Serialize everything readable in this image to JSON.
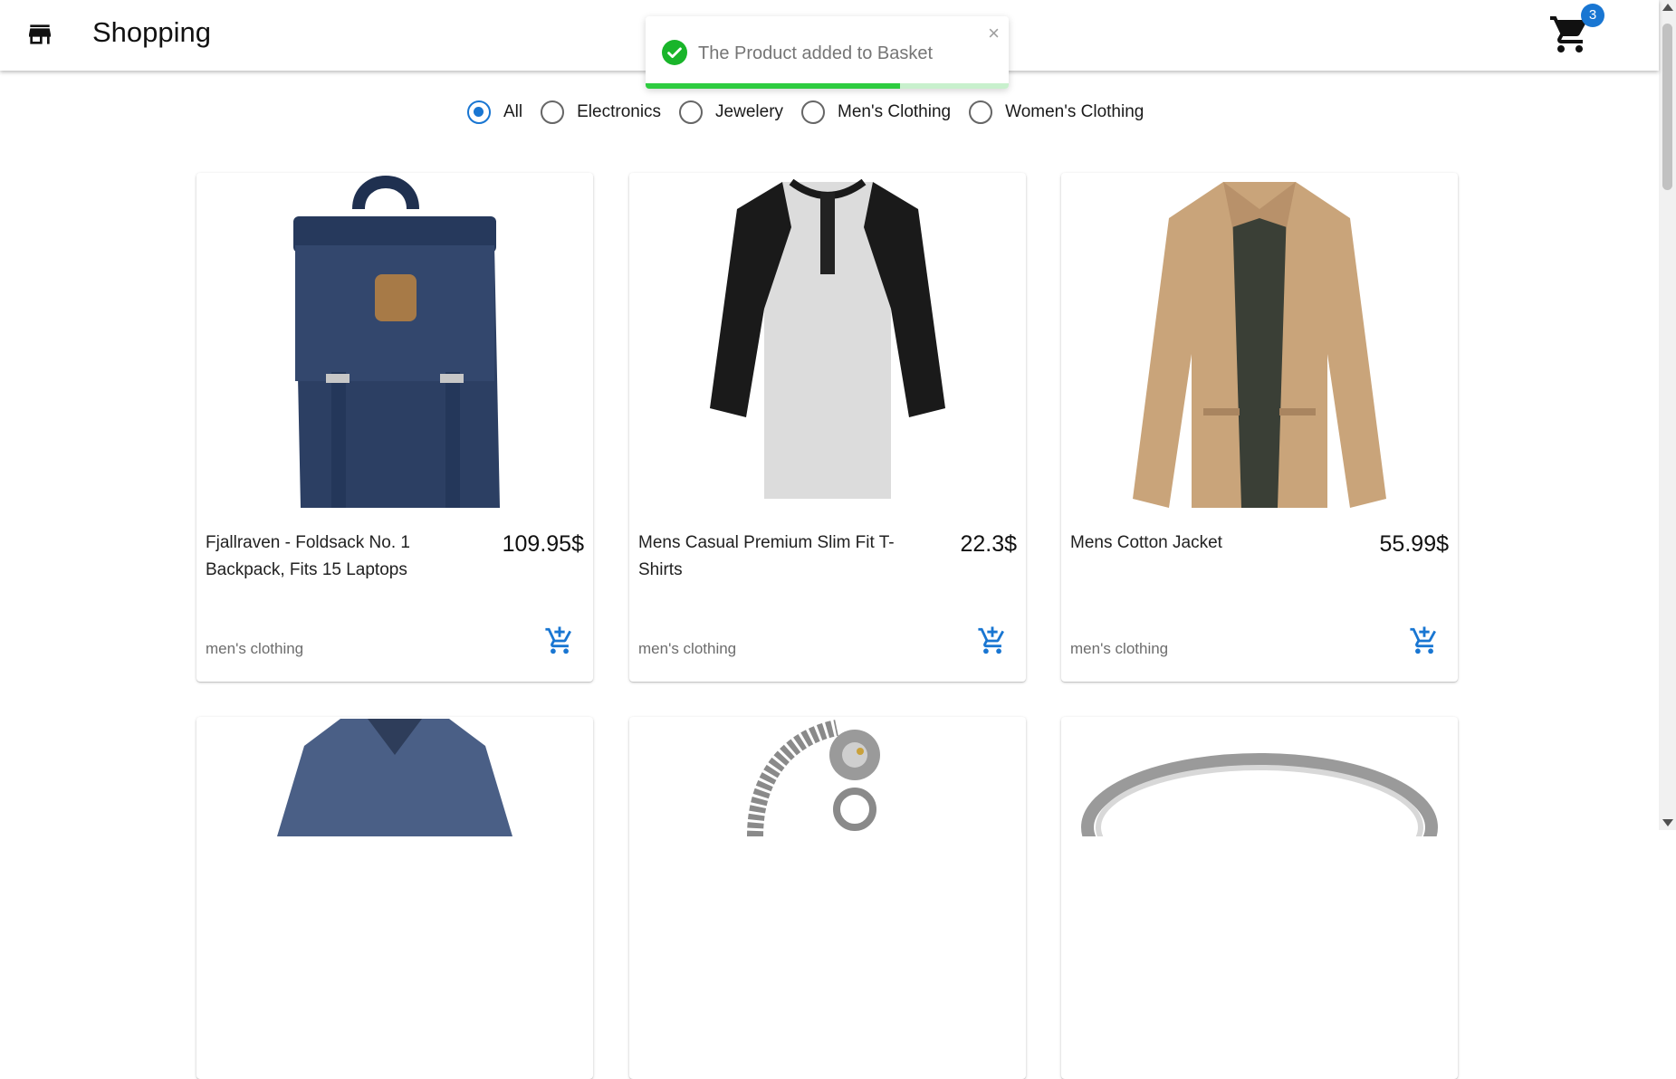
{
  "header": {
    "title": "Shopping",
    "cart_count": "3"
  },
  "toast": {
    "message": "The Product added to Basket",
    "close": "×",
    "progress_pct": 70
  },
  "filters": [
    {
      "label": "All",
      "checked": true
    },
    {
      "label": "Electronics",
      "checked": false
    },
    {
      "label": "Jewelery",
      "checked": false
    },
    {
      "label": "Men's Clothing",
      "checked": false
    },
    {
      "label": "Women's Clothing",
      "checked": false
    }
  ],
  "products": [
    {
      "title": "Fjallraven - Foldsack No. 1 Backpack, Fits 15 Laptops",
      "price": "109.95$",
      "category": "men's clothing"
    },
    {
      "title": "Mens Casual Premium Slim Fit T-Shirts",
      "price": "22.3$",
      "category": "men's clothing"
    },
    {
      "title": "Mens Cotton Jacket",
      "price": "55.99$",
      "category": "men's clothing"
    }
  ],
  "colors": {
    "accent": "#1976d2",
    "success": "#2ecc40"
  }
}
